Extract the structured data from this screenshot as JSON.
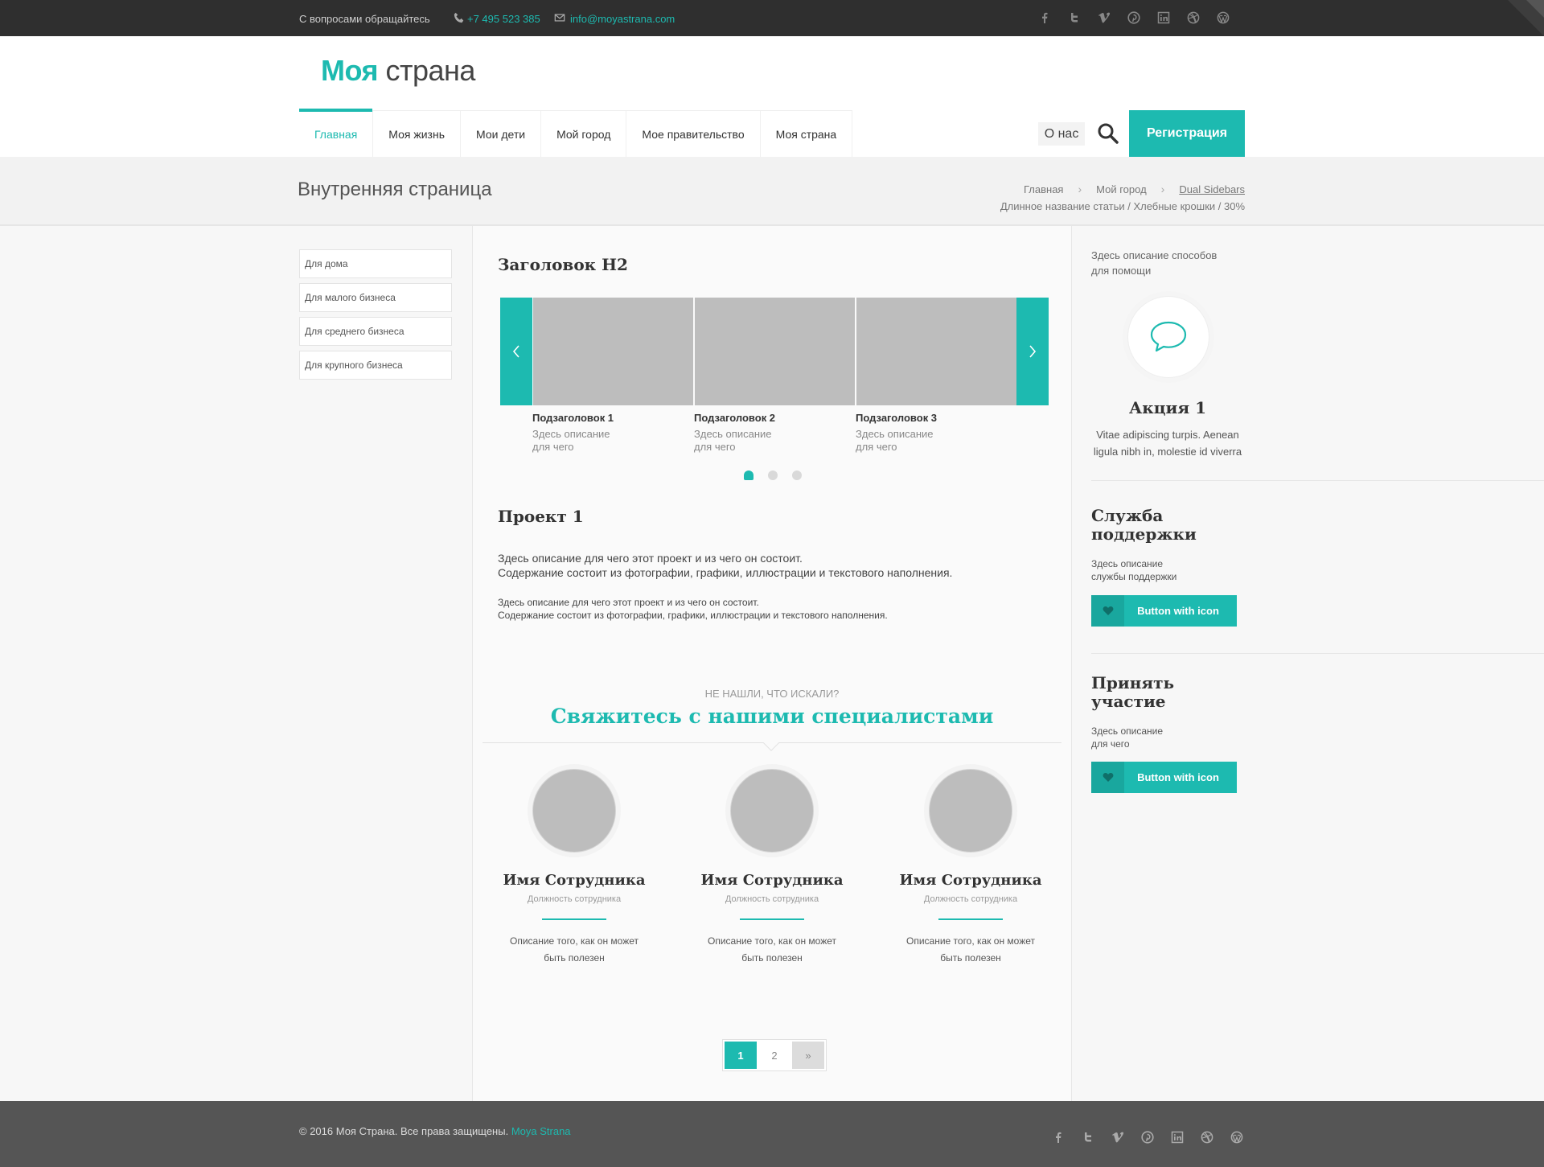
{
  "topbar": {
    "contact_text": "С вопросами обращайтесь",
    "phone": "+7 495 523 385",
    "email": "info@moyastrana.com",
    "social_icons": [
      "facebook-icon",
      "twitter-icon",
      "vimeo-icon",
      "pinterest-icon",
      "linkedin-icon",
      "dribbble-icon",
      "wordpress-icon"
    ]
  },
  "brand": {
    "logo_bold": "Моя",
    "logo_regular": " страна",
    "accent_color": "#1dbab0"
  },
  "nav": {
    "items": [
      "Главная",
      "Моя жизнь",
      "Мои дети",
      "Мой город",
      "Мое правительство",
      "Моя страна"
    ],
    "active": "Главная",
    "about": "О нас",
    "register": "Регистрация"
  },
  "page": {
    "title": "Внутренняя страница",
    "breadcrumbs": [
      "Главная",
      "Мой город",
      "Dual Sidebars"
    ],
    "breadcrumb_sub": "Длинное название статьи / Хлебные крошки / 30%"
  },
  "left_menu": [
    "Для дома",
    "Для малого бизнеса",
    "Для среднего бизнеса",
    "Для крупного бизнеса"
  ],
  "main": {
    "heading": "Заголовок H2",
    "carousel": [
      {
        "title": "Подзаголовок 1",
        "desc": "Здесь описание для чего"
      },
      {
        "title": "Подзаголовок 2",
        "desc": "Здесь описание для чего"
      },
      {
        "title": "Подзаголовок 3",
        "desc": "Здесь описание для чего"
      }
    ],
    "project_title": "Проект 1",
    "project_p1_line1": "Здесь описание для чего этот проект и из чего он состоит.",
    "project_p1_line2": "Содержание состоит из фотографии, графики, иллюстрации и текстового наполнения.",
    "project_p2_line1": "Здесь описание для чего этот проект и из чего он состоит.",
    "project_p2_line2": "Содержание состоит из фотографии, графики, иллюстрации и текстового наполнения.",
    "cta_sub": "Не нашли, что искали?",
    "cta_title": "Свяжитесь с нашими специалистами",
    "team": [
      {
        "name": "Имя Сотрудника",
        "position": "Должность сотрудника",
        "desc": "Описание того, как он может быть полезен"
      },
      {
        "name": "Имя Сотрудника",
        "position": "Должность сотрудника",
        "desc": "Описание того, как он может быть полезен"
      },
      {
        "name": "Имя Сотрудника",
        "position": "Должность сотрудника",
        "desc": "Описание того, как он может быть полезен"
      }
    ],
    "pagination": {
      "pages": [
        "1",
        "2"
      ],
      "current": "1",
      "next": "»"
    }
  },
  "right": {
    "intro": "Здесь описание способов для помощи",
    "promo_title": "Акция 1",
    "promo_desc": "Vitae adipiscing turpis. Aenean ligula nibh in, molestie id viverra",
    "support_title": "Служба поддержки",
    "support_desc": "Здесь описание службы поддержки",
    "support_button": "Button with icon",
    "join_title": "Принять участие",
    "join_desc": "Здесь описание для чего",
    "join_button": "Button with icon"
  },
  "footer": {
    "copyright": "© 2016 Моя Страна. Все права защищены.",
    "brand_link": "Moya Strana"
  }
}
